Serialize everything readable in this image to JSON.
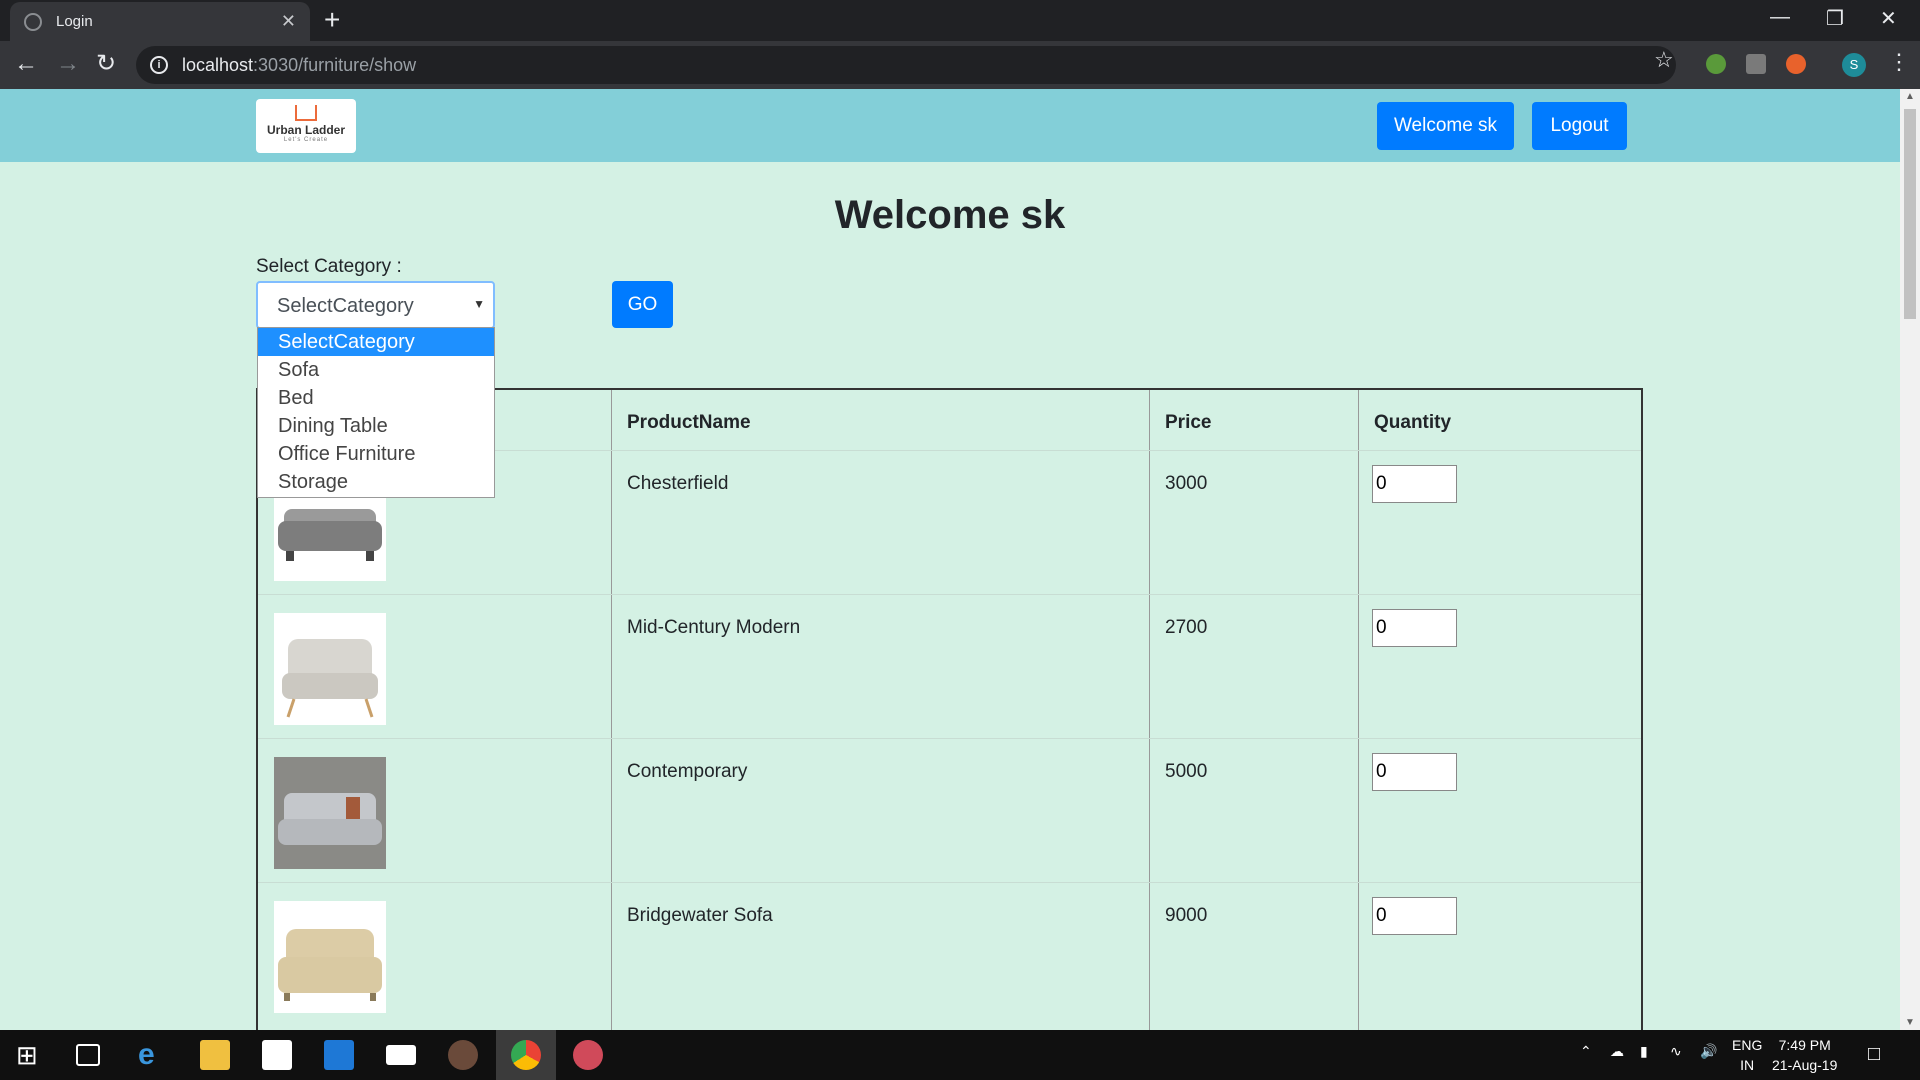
{
  "browser": {
    "tab_title": "Login",
    "tab_close": "✕",
    "new_tab": "+",
    "url_host": "localhost",
    "url_path": ":3030/furniture/show"
  },
  "header": {
    "logo_name": "Urban Ladder",
    "logo_tagline": "Let's Create",
    "welcome_button": "Welcome sk",
    "logout_button": "Logout"
  },
  "main": {
    "heading": "Welcome sk",
    "category_label": "Select Category :",
    "select_value": "SelectCategory",
    "go_button": "GO",
    "options": [
      "SelectCategory",
      "Sofa",
      "Bed",
      "Dining Table",
      "Office Furniture",
      "Storage"
    ]
  },
  "table": {
    "headers": [
      "ProductName",
      "Price",
      "Quantity"
    ],
    "rows": [
      {
        "name": "Chesterfield",
        "price": "3000",
        "qty": "0",
        "img_color": "#9a9a9a"
      },
      {
        "name": "Mid-Century Modern",
        "price": "2700",
        "qty": "0",
        "img_color": "#d8d6d0"
      },
      {
        "name": "Contemporary",
        "price": "5000",
        "qty": "0",
        "img_color": "#b5b8bc"
      },
      {
        "name": "Bridgewater Sofa",
        "price": "9000",
        "qty": "0",
        "img_color": "#d9c9a2"
      }
    ]
  },
  "taskbar": {
    "lang": "ENG",
    "region": "IN",
    "time": "7:49 PM",
    "date": "21-Aug-19"
  },
  "colors": {
    "accent": "#007bff",
    "header_bg": "#83cfd8",
    "page_bg": "#d4f1e4"
  }
}
